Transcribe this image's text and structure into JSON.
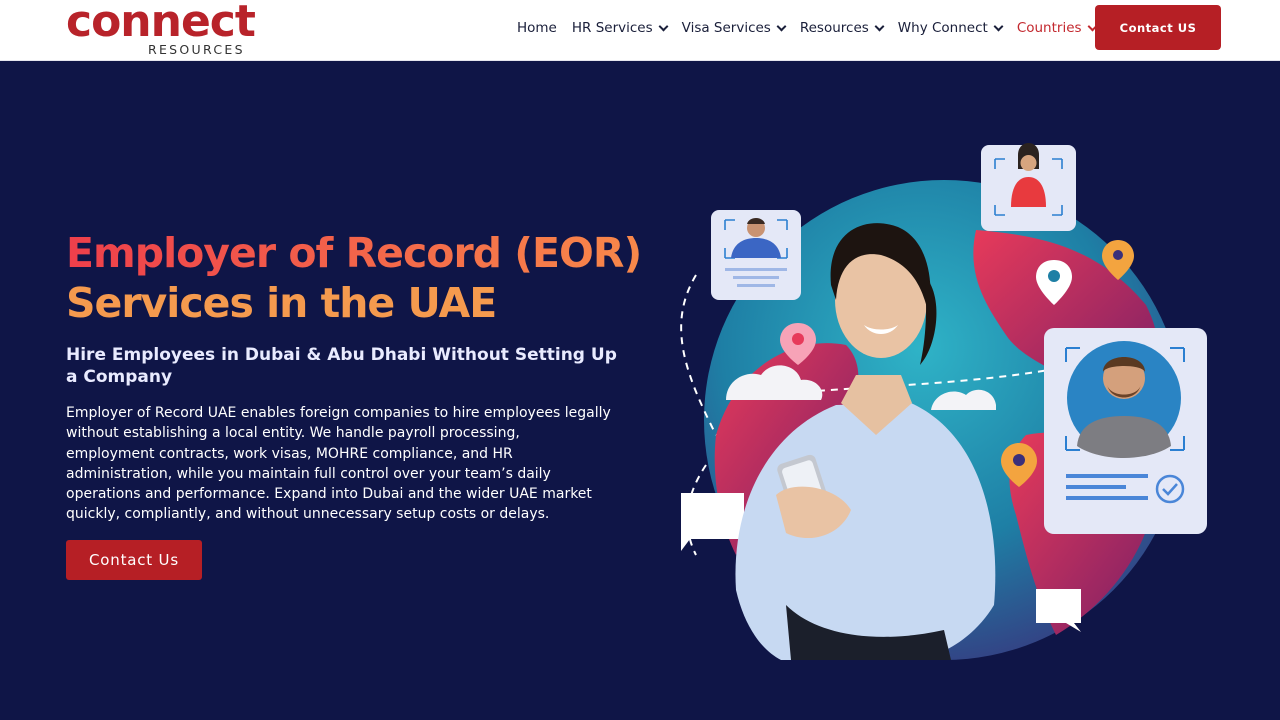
{
  "header": {
    "logo_text": "connect",
    "logo_subtext": "RESOURCES",
    "nav": [
      {
        "label": "Home",
        "has_dropdown": false,
        "active": false
      },
      {
        "label": "HR Services",
        "has_dropdown": true,
        "active": false
      },
      {
        "label": "Visa Services",
        "has_dropdown": true,
        "active": false
      },
      {
        "label": "Resources",
        "has_dropdown": true,
        "active": false
      },
      {
        "label": "Why Connect",
        "has_dropdown": true,
        "active": false
      },
      {
        "label": "Countries",
        "has_dropdown": true,
        "active": true
      }
    ],
    "cta_label": "Contact US"
  },
  "hero": {
    "title_line1": "Employer of Record (EOR)",
    "title_line2": "Services in the UAE",
    "subtitle": "Hire Employees in Dubai & Abu Dhabi Without Setting Up a Company",
    "body": "Employer of Record UAE enables foreign companies to hire employees legally without establishing a local entity. We handle payroll processing, employment contracts, work visas, MOHRE compliance, and HR administration, while you maintain full control over your team’s daily operations and performance. Expand into Dubai and the wider UAE market quickly, compliantly, and without unnecessary setup costs or delays.",
    "cta_label": "Contact Us"
  },
  "colors": {
    "background": "#0f1547",
    "brand_red": "#b61f25",
    "title_gradient_start": "#ee3f4b",
    "title_gradient_end": "#f8894a",
    "nav_active": "#c3282e"
  },
  "icons": [
    "chevron-down-icon",
    "location-pin-icon",
    "checkmark-icon",
    "chat-bubble-icon",
    "cloud-icon"
  ]
}
